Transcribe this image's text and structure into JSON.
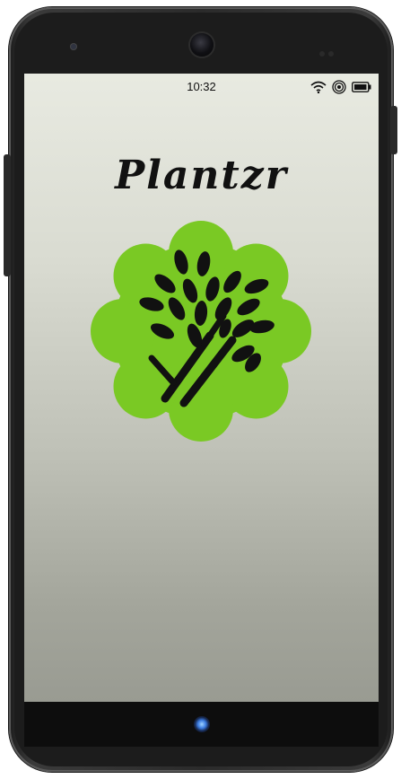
{
  "status_bar": {
    "time": "10:32",
    "icons": [
      "wifi-icon",
      "hotspot-icon",
      "battery-icon"
    ]
  },
  "app": {
    "title": "Plantzr",
    "logo_icon": "tree-leaf-icon"
  },
  "colors": {
    "logo_green": "#7ac924",
    "logo_foreground": "#111111",
    "screen_top": "#e8eae1",
    "screen_bottom": "#999b92"
  },
  "nav": {
    "home_icon": "home-button-icon"
  }
}
